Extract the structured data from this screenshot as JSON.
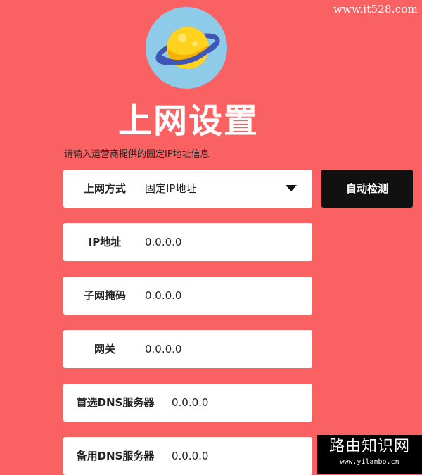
{
  "watermark_top": "www.it528.com",
  "title": "上网设置",
  "hint": "请输入运营商提供的固定IP地址信息",
  "connection": {
    "label": "上网方式",
    "value": "固定IP地址",
    "auto_detect_label": "自动检测"
  },
  "fields": {
    "ip": {
      "label": "IP地址",
      "value": "0.0.0.0"
    },
    "mask": {
      "label": "子网掩码",
      "value": "0.0.0.0"
    },
    "gateway": {
      "label": "网关",
      "value": "0.0.0.0"
    },
    "dns1": {
      "label": "首选DNS服务器",
      "value": "0.0.0.0"
    },
    "dns2": {
      "label": "备用DNS服务器",
      "value": "0.0.0.0"
    }
  },
  "watermark_bottom": {
    "title": "路由知识网",
    "url": "www.yilanbo.cn"
  },
  "colors": {
    "background": "#f96163",
    "button": "#111111",
    "planet_sky": "#8ecbe8",
    "planet_body": "#ffd21e",
    "planet_ring": "#3f56b7"
  },
  "icons": {
    "logo": "planet-icon",
    "dropdown": "caret-down-icon"
  }
}
